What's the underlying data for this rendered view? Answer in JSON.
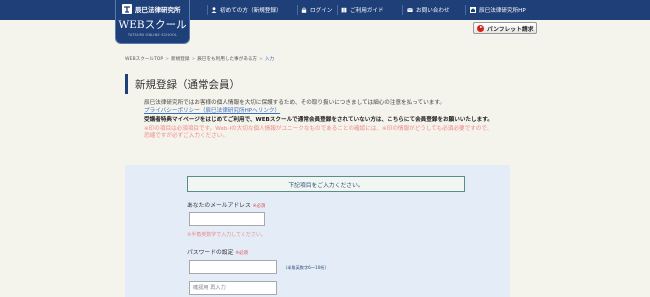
{
  "header": {
    "brand_name": "辰巳法律研究所",
    "product": "WEBスクール",
    "tagline": "TATSUMI ONLINE SCHOOL",
    "nav": [
      {
        "label": "初めての方（新規登録）",
        "icon": "person-icon"
      },
      {
        "label": "ログイン",
        "icon": "lock-icon"
      },
      {
        "label": "ご利用ガイド",
        "icon": "book-icon"
      },
      {
        "label": "お問い合わせ",
        "icon": "mail-icon"
      },
      {
        "label": "辰巳法律研究所HP",
        "icon": "home-icon"
      }
    ],
    "pamphlet_button": "パンフレット請求"
  },
  "breadcrumb": {
    "items": [
      "WEBスクールTOP",
      "新規登録",
      "辰巳をも利用した事がある方",
      "入力"
    ]
  },
  "main": {
    "title": "新規登録（通常会員）",
    "intro": "辰巳法律研究所ではお客様の個人情報を大切に保護するため、その取り扱いにつきましては細心の注意を払っています。",
    "privacy_link": "プライバシーポリシー（辰巳法律研究所HPへリンク）",
    "member_note": "受講者特典マイページをはじめてご利用で、WEBスクールで通常会員登録をされていない方は、こちらにて会員登録をお願いいたします。",
    "warning_lines": [
      "※印の項目は必須項目です。Web-Iの大切な個人情報がユニークなものであることの確認には、※印の情報がどうしても必須必要ですので、",
      "恐縮ですが必ずご入力ください。",
      ""
    ]
  },
  "form": {
    "notice": "下記項目をご入力ください。",
    "email_label": "あなたのメールアドレス",
    "required_mark": "※必須",
    "email_value": "",
    "email_hint": "※半角英数字で入力してください。",
    "password_label": "パスワードの設定",
    "password_value": "",
    "password_hint": "（半角英数字6～10桁）",
    "password_confirm_placeholder": "確認用 再入力"
  },
  "colors": {
    "header_bg": "#1f3f78",
    "link": "#3a6fc0",
    "warning": "#f08a8a",
    "panel_bg": "#e3ecf7"
  }
}
